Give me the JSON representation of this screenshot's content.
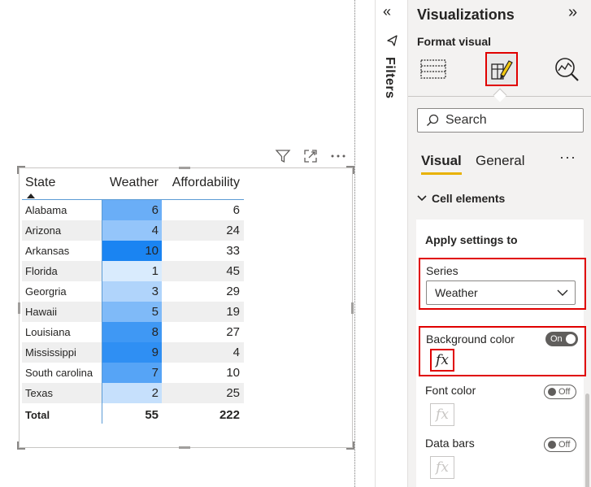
{
  "table": {
    "headers": {
      "state": "State",
      "weather": "Weather",
      "affordability": "Affordability"
    },
    "rows": [
      {
        "state": "Alabama",
        "weather": "6",
        "affordability": "6",
        "bg": "#6aaef7"
      },
      {
        "state": "Arizona",
        "weather": "4",
        "affordability": "24",
        "bg": "#94c5fa"
      },
      {
        "state": "Arkansas",
        "weather": "10",
        "affordability": "33",
        "bg": "#1a84f2"
      },
      {
        "state": "Florida",
        "weather": "1",
        "affordability": "45",
        "bg": "#d9ebfd"
      },
      {
        "state": "Georgria",
        "weather": "3",
        "affordability": "29",
        "bg": "#b0d4fb"
      },
      {
        "state": "Hawaii",
        "weather": "5",
        "affordability": "19",
        "bg": "#7fbaf8"
      },
      {
        "state": "Louisiana",
        "weather": "8",
        "affordability": "27",
        "bg": "#3f98f4"
      },
      {
        "state": "Mississippi",
        "weather": "9",
        "affordability": "4",
        "bg": "#2f8ff3"
      },
      {
        "state": "South carolina",
        "weather": "7",
        "affordability": "10",
        "bg": "#56a4f6"
      },
      {
        "state": "Texas",
        "weather": "2",
        "affordability": "25",
        "bg": "#c6e0fc"
      }
    ],
    "total": {
      "label": "Total",
      "weather": "55",
      "affordability": "222"
    }
  },
  "filters": {
    "label": "Filters"
  },
  "viz_pane": {
    "title": "Visualizations",
    "format_visual_label": "Format visual",
    "search_placeholder": "Search",
    "tabs": {
      "visual": "Visual",
      "general": "General",
      "more": "···"
    },
    "section": "Cell elements",
    "apply_settings_label": "Apply settings to",
    "series_label": "Series",
    "series_value": "Weather",
    "background_color": {
      "label": "Background color",
      "toggle": "On"
    },
    "font_color": {
      "label": "Font color",
      "toggle": "Off"
    },
    "data_bars": {
      "label": "Data bars",
      "toggle": "Off"
    },
    "fx": "fx"
  },
  "colors": {
    "accent_yellow": "#e8b200",
    "highlight_red": "#e00000",
    "table_line": "#5b9bd5"
  }
}
